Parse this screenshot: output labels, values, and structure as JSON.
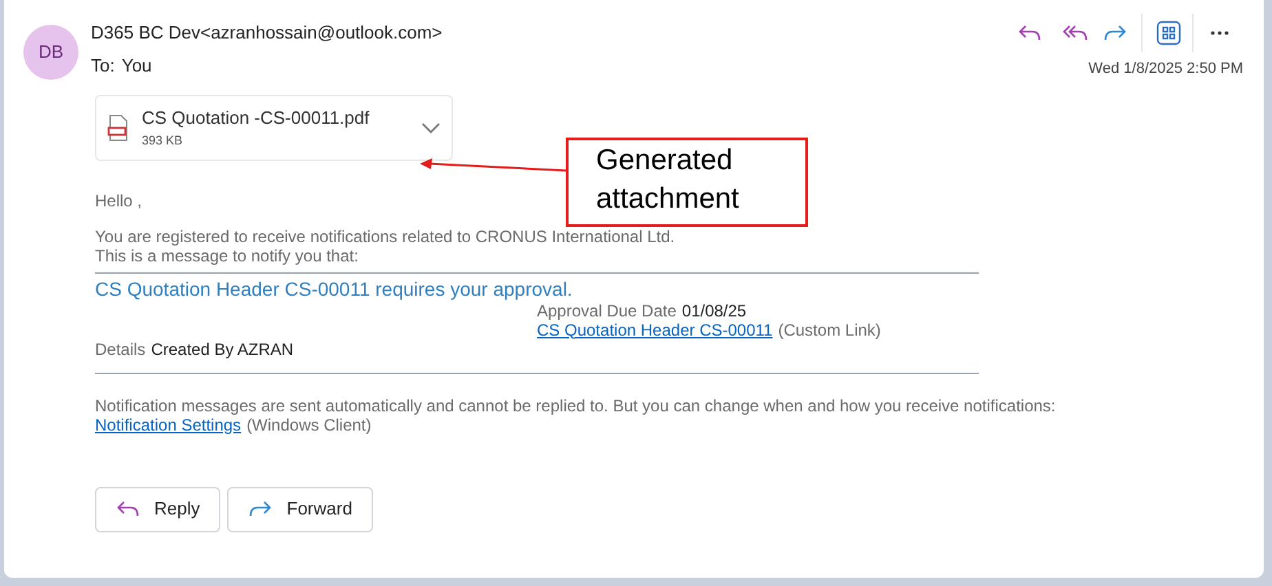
{
  "message": {
    "avatar_initials": "DB",
    "from": "D365 BC Dev<azranhossain@outlook.com>",
    "to_label": "To:",
    "to": "You",
    "date": "Wed 1/8/2025 2:50 PM"
  },
  "toolbar": [
    {
      "kind": "reply"
    },
    {
      "kind": "reply_all"
    },
    {
      "kind": "forward"
    },
    {
      "kind": "apps"
    },
    {
      "kind": "more"
    }
  ],
  "attachment": {
    "name": "CS Quotation -CS-00011.pdf",
    "size": "393 KB"
  },
  "annotation": {
    "text": "Generated attachment"
  },
  "body": {
    "greeting": "Hello ,",
    "intro": [
      "You are registered to receive notifications related to CRONUS International Ltd.",
      "This is a message to notify you that:"
    ],
    "headline": "CS Quotation Header CS-00011 requires your approval.",
    "due_label": "Approval Due Date",
    "due_value": "01/08/25",
    "record_link": "CS Quotation Header CS-00011",
    "record_link_note": "(Custom Link)",
    "details_label": "Details",
    "details_value": "Created By AZRAN",
    "footer": "Notification messages are sent automatically and cannot be replied to. But you can change when and how you receive notifications:",
    "settings_link": "Notification Settings",
    "settings_note": "(Windows Client)"
  },
  "actions": [
    {
      "kind": "reply",
      "label": "Reply"
    },
    {
      "kind": "forward",
      "label": "Forward"
    }
  ]
}
